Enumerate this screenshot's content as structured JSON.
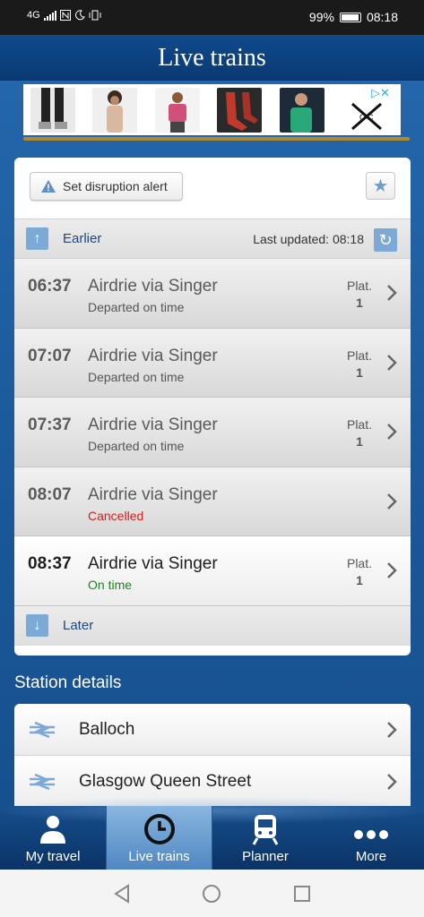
{
  "status_bar": {
    "network": "4G",
    "battery": "99%",
    "time": "08:18"
  },
  "header": {
    "title": "Live trains"
  },
  "ad": {
    "choices_icon": "adchoices-icon"
  },
  "alert": {
    "set_alert_label": "Set disruption alert",
    "favourite_icon": "star-icon"
  },
  "departures": {
    "earlier_label": "Earlier",
    "last_updated": "Last updated: 08:18",
    "later_label": "Later",
    "plat_label": "Plat.",
    "rows": [
      {
        "time": "06:37",
        "destination": "Airdrie via Singer",
        "status": "Departed on time",
        "platform": "1"
      },
      {
        "time": "07:07",
        "destination": "Airdrie via Singer",
        "status": "Departed on time",
        "platform": "1"
      },
      {
        "time": "07:37",
        "destination": "Airdrie via Singer",
        "status": "Departed on time",
        "platform": "1"
      },
      {
        "time": "08:07",
        "destination": "Airdrie via Singer",
        "status": "Cancelled",
        "platform": ""
      },
      {
        "time": "08:37",
        "destination": "Airdrie via Singer",
        "status": "On time",
        "platform": "1"
      }
    ]
  },
  "station_details": {
    "title": "Station details",
    "stations": [
      "Balloch",
      "Glasgow Queen Street"
    ]
  },
  "tabs": [
    {
      "label": "My travel",
      "icon": "person-icon"
    },
    {
      "label": "Live trains",
      "icon": "clock-icon"
    },
    {
      "label": "Planner",
      "icon": "train-icon"
    },
    {
      "label": "More",
      "icon": "more-dots-icon"
    }
  ],
  "colors": {
    "header_blue": "#0f4a8c",
    "cancelled_red": "#d0201e",
    "on_time_green": "#18861f",
    "accent_light_blue": "#7ca9d6"
  }
}
